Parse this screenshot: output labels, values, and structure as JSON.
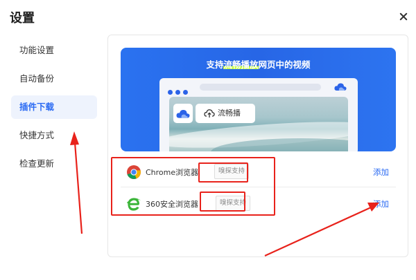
{
  "dialog": {
    "title": "设置"
  },
  "sidebar": {
    "items": [
      {
        "label": "功能设置",
        "active": false
      },
      {
        "label": "自动备份",
        "active": false
      },
      {
        "label": "插件下载",
        "active": true
      },
      {
        "label": "快捷方式",
        "active": false
      },
      {
        "label": "检查更新",
        "active": false
      }
    ]
  },
  "banner": {
    "title_pre": "支持",
    "title_highlight": "流畅播放",
    "title_post": "网页中的视频",
    "play_label": "流畅播",
    "accent": "#2a6af3",
    "highlight_color": "#c6ff3a"
  },
  "browsers": [
    {
      "name": "Chrome浏览器",
      "tag": "嗅探支持",
      "action": "添加",
      "icon": "chrome-icon"
    },
    {
      "name": "360安全浏览器",
      "tag": "嗅探支持",
      "action": "添加",
      "icon": "ie-360-icon"
    }
  ],
  "annotation_color": "#e8221b"
}
